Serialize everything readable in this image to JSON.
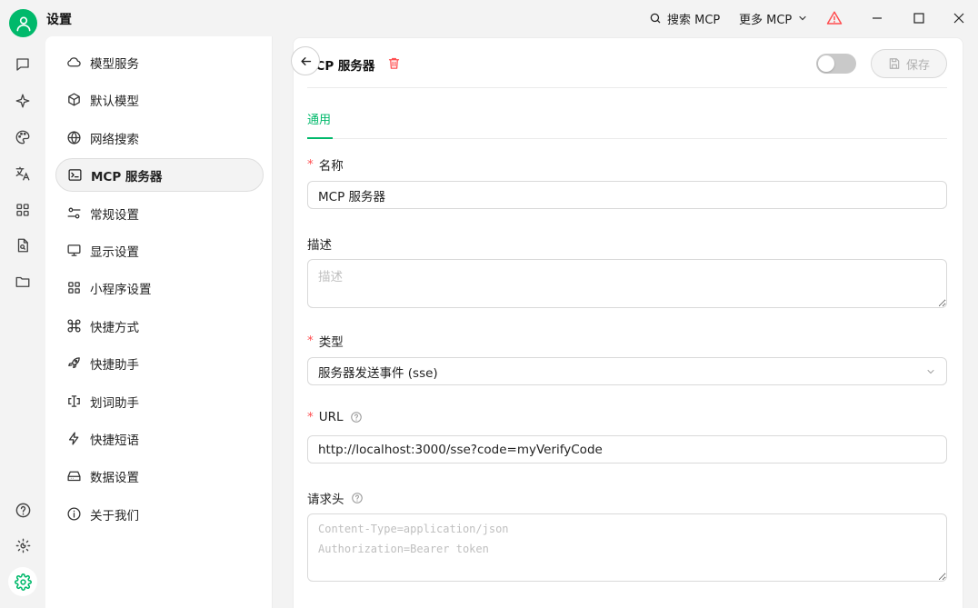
{
  "app": {
    "title": "设置"
  },
  "topbar": {
    "search_mcp_label": "搜索 MCP",
    "more_mcp_label": "更多 MCP"
  },
  "rail": {
    "items": [
      "chat-icon",
      "sparkle-icon",
      "palette-icon",
      "translate-icon",
      "apps-icon",
      "file-search-icon",
      "folder-icon",
      "help-icon",
      "theme-icon",
      "settings-icon"
    ]
  },
  "menu": {
    "items": [
      {
        "label": "模型服务",
        "icon": "cloud-icon"
      },
      {
        "label": "默认模型",
        "icon": "cube-icon"
      },
      {
        "label": "网络搜索",
        "icon": "globe-icon"
      },
      {
        "label": "MCP 服务器",
        "icon": "terminal-icon"
      },
      {
        "label": "常规设置",
        "icon": "sliders-icon"
      },
      {
        "label": "显示设置",
        "icon": "monitor-icon"
      },
      {
        "label": "小程序设置",
        "icon": "grid-icon"
      },
      {
        "label": "快捷方式",
        "icon": "command-icon"
      },
      {
        "label": "快捷助手",
        "icon": "rocket-icon"
      },
      {
        "label": "划词助手",
        "icon": "text-cursor-icon"
      },
      {
        "label": "快捷短语",
        "icon": "bolt-icon"
      },
      {
        "label": "数据设置",
        "icon": "hard-drive-icon"
      },
      {
        "label": "关于我们",
        "icon": "info-icon"
      }
    ],
    "active_index": 3
  },
  "panel": {
    "title": "MCP 服务器",
    "save_label": "保存",
    "enabled": false,
    "tabs": [
      {
        "label": "通用"
      }
    ]
  },
  "form": {
    "name": {
      "label": "名称",
      "required": true,
      "value": "MCP 服务器"
    },
    "description": {
      "label": "描述",
      "required": false,
      "value": "",
      "placeholder": "描述"
    },
    "type": {
      "label": "类型",
      "required": true,
      "value": "服务器发送事件 (sse)"
    },
    "url": {
      "label": "URL",
      "required": true,
      "value": "http://localhost:3000/sse?code=myVerifyCode"
    },
    "headers": {
      "label": "请求头",
      "required": false,
      "value": "",
      "placeholder": "Content-Type=application/json\nAuthorization=Bearer token"
    }
  },
  "colors": {
    "accent": "#00b96b",
    "danger": "#ff4d4f",
    "warning": "#ff4d4f"
  }
}
